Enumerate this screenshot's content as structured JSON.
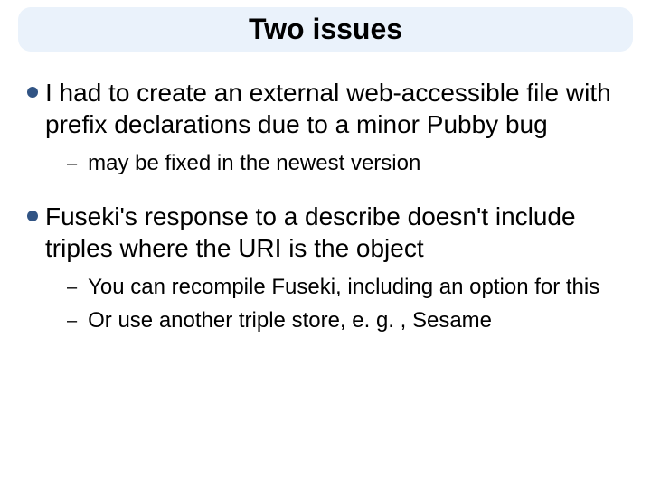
{
  "title": "Two issues",
  "bullets": [
    {
      "text": "I had to create an external web-accessible file with prefix declarations due to a minor Pubby bug",
      "subs": [
        "may be fixed in the newest version"
      ]
    },
    {
      "text": "Fuseki's response to a describe doesn't include triples where the URI is the object",
      "subs": [
        "You can recompile Fuseki, including an option for this",
        "Or use another triple store, e. g. , Sesame"
      ]
    }
  ]
}
